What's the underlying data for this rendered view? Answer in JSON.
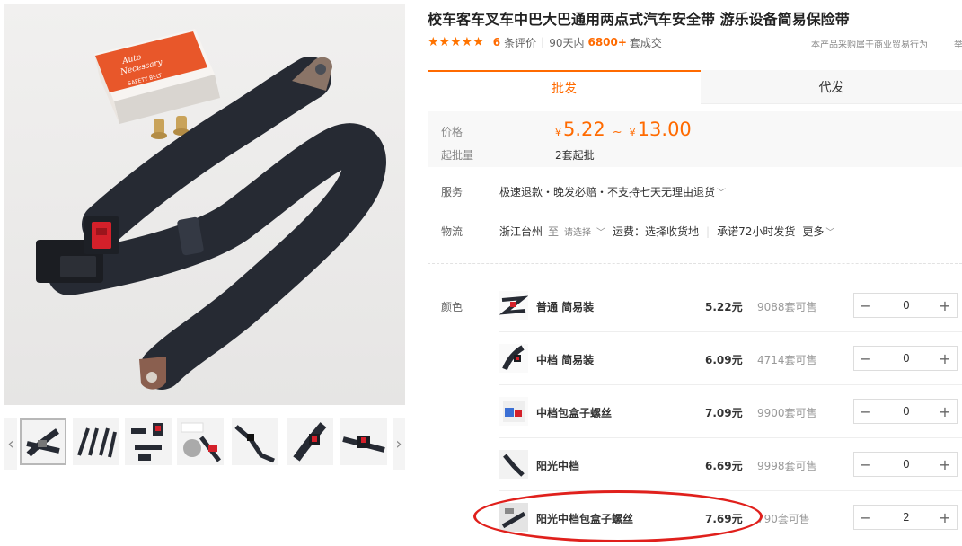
{
  "product": {
    "title": "校车客车叉车中巴大巴通用两点式汽车安全带 游乐设备简易保险带"
  },
  "rating": {
    "stars": "★★★★★",
    "review_count": "6",
    "review_label": "条评价",
    "separator": "|",
    "days_label": "90天内",
    "sold_count": "6800+",
    "sold_label": "套成交"
  },
  "notice": "本产品采购属于商业贸易行为",
  "notice_cut": "举",
  "tabs": {
    "wholesale": "批发",
    "dropship": "代发"
  },
  "price_box": {
    "price_label": "价格",
    "currency": "¥",
    "price_min": "5.22",
    "tilde": "~",
    "price_max": "13.00",
    "moq_label": "起批量",
    "moq_value": "2套起批"
  },
  "service": {
    "label": "服务",
    "value": "极速退款・晚发必赔・不支持七天无理由退货",
    "chevron": "﹀"
  },
  "logistics": {
    "label": "物流",
    "origin": "浙江台州",
    "to_label": "至",
    "select_label": "请选择",
    "chevron": "﹀",
    "freight": "运费：选择收货地",
    "separator": "|",
    "promise": "承诺72小时发货",
    "more": "更多",
    "more_chevron": "﹀"
  },
  "variants": {
    "label": "颜色",
    "minus_sign": "−",
    "plus_sign": "+",
    "items": [
      {
        "name": "普通 简易装",
        "price": "5.22元",
        "stock": "9088套可售",
        "qty": "0"
      },
      {
        "name": "中档 简易装",
        "price": "6.09元",
        "stock": "4714套可售",
        "qty": "0"
      },
      {
        "name": "中档包盒子螺丝",
        "price": "7.09元",
        "stock": "9900套可售",
        "qty": "0"
      },
      {
        "name": "阳光中档",
        "price": "6.69元",
        "stock": "9998套可售",
        "qty": "0"
      },
      {
        "name": "阳光中档包盒子螺丝",
        "price": "7.69元",
        "stock": "790套可售",
        "qty": "2"
      }
    ]
  },
  "gallery": {
    "prev_arrow": "‹",
    "next_arrow": "›",
    "box_text_lines": [
      "Auto",
      "Necessary",
      "SAFETY BELT"
    ]
  },
  "colors": {
    "accent": "#ff6a00",
    "highlight": "#e0201c",
    "belt": "#262a33",
    "box": "#e8572a"
  }
}
